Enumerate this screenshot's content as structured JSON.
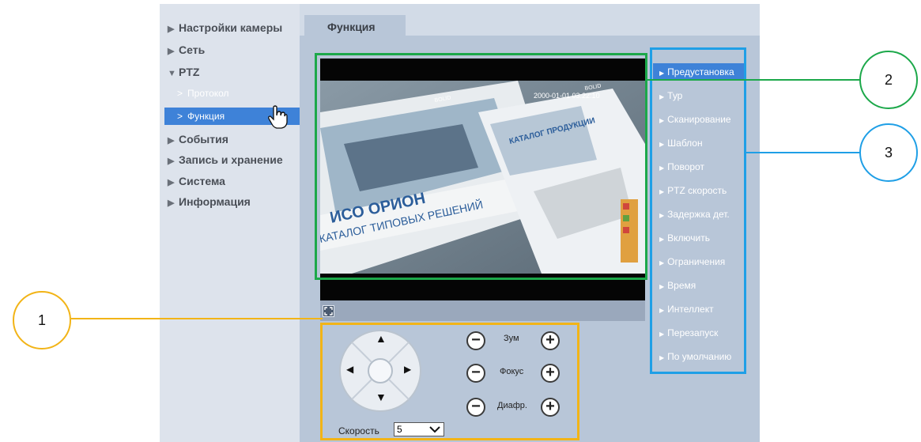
{
  "sidebar": {
    "items": [
      {
        "label": "Настройки камеры",
        "arrow": "▶"
      },
      {
        "label": "Сеть",
        "arrow": "▶"
      },
      {
        "label": "PTZ",
        "arrow": "▼"
      },
      {
        "label": "Протокол",
        "arrow": ">"
      },
      {
        "label": "Функция",
        "arrow": ">"
      },
      {
        "label": "События",
        "arrow": "▶"
      },
      {
        "label": "Запись и хранение",
        "arrow": "▶"
      },
      {
        "label": "Система",
        "arrow": "▶"
      },
      {
        "label": "Информация",
        "arrow": "▶"
      }
    ]
  },
  "tab": {
    "label": "Функция"
  },
  "video": {
    "overlay_timestamp": "2000-01-01 03:22:10",
    "overlay_brand": "BOLID",
    "book_title_1": "ИСО ОРИОН",
    "book_title_2": "КАТАЛОГ ТИПОВЫХ РЕШЕНИЙ",
    "book_title_3": "КАТАЛОГ ПРОДУКЦИИ"
  },
  "ptz": {
    "zoom_label": "Зум",
    "focus_label": "Фокус",
    "iris_label": "Диафр.",
    "minus": "−",
    "plus": "+",
    "speed_label": "Скорость",
    "speed_value": "5",
    "arrow_up": "▲",
    "arrow_down": "▼",
    "arrow_left": "◀",
    "arrow_right": "▶"
  },
  "menu": {
    "items": [
      "Предустановка",
      "Тур",
      "Сканирование",
      "Шаблон",
      "Поворот",
      "PTZ скорость",
      "Задержка дет.",
      "Включить",
      "Ограничения",
      "Время",
      "Интеллект",
      "Перезапуск",
      "По умолчанию"
    ]
  },
  "callouts": {
    "one": "1",
    "two": "2",
    "three": "3"
  },
  "colors": {
    "green": "#1ca84a",
    "yellow": "#f2b417",
    "blue": "#1f9fe6",
    "selected": "#3e82d8"
  }
}
